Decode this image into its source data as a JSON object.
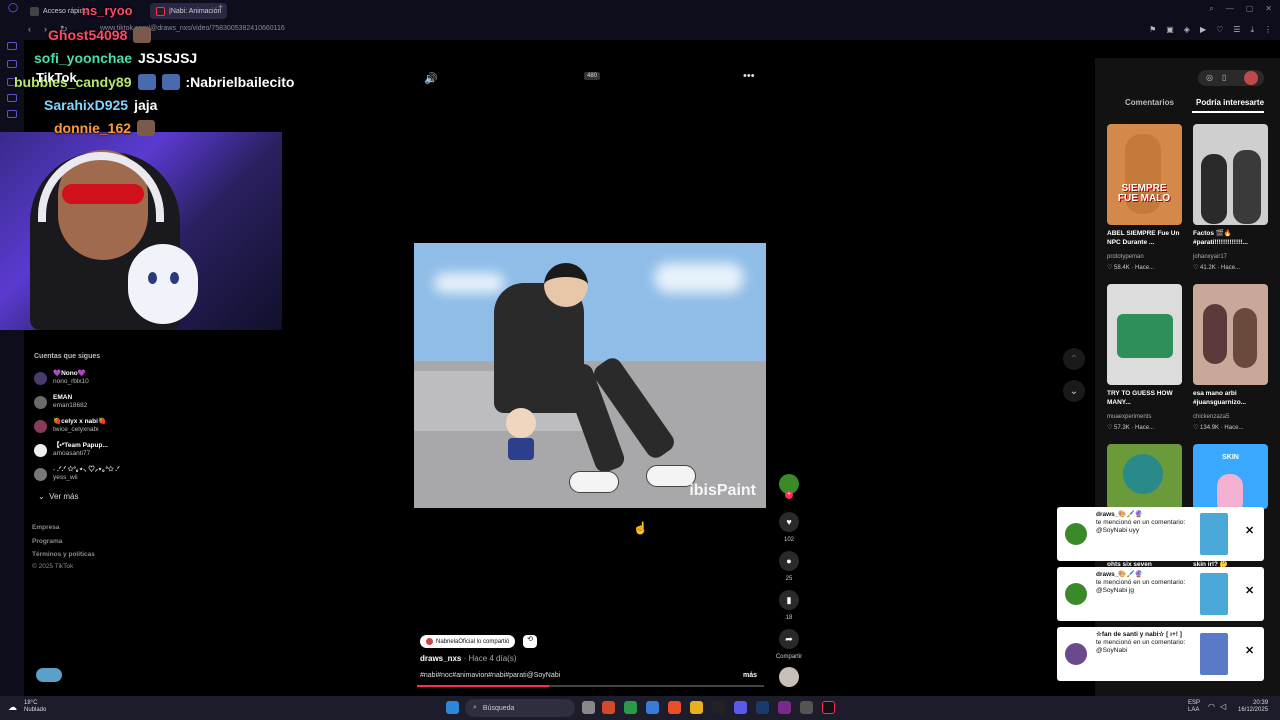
{
  "browser": {
    "tabs": [
      {
        "label": "Acceso rápido"
      },
      {
        "label": "|Nabi: Animación"
      }
    ],
    "url": "www.tiktok.com/@draws_nxs/video/7583005382410660116"
  },
  "chat": {
    "lines": [
      {
        "user": "Ghost54098",
        "message": "",
        "color": "#ff4a6a"
      },
      {
        "user": "sofi_yoonchae",
        "message": "JSJSJSJ",
        "color": "#46e0a8"
      },
      {
        "user": "bubbles_candy89",
        "message": ":Nabrielbailecito",
        "color": "#b6e86a"
      },
      {
        "user": "SarahixD925",
        "message": "jaja",
        "color": "#7fd6ff"
      },
      {
        "user": "donnie_162",
        "message": "",
        "color": "#ff9a3a"
      }
    ],
    "header_user": "ns_ryoo"
  },
  "tiktok": {
    "logo": "TikTok",
    "following_title": "Cuentas que sigues",
    "following": [
      {
        "name": "💜Nono💜",
        "handle": "nono_rblx10"
      },
      {
        "name": "EMAN",
        "handle": "eman18682"
      },
      {
        "name": "🍓celyx x nabi🍓",
        "handle": "twice_celyxnabi"
      },
      {
        "name": "【•*Team Papup...",
        "handle": "amoasanti77"
      },
      {
        "name": "˖ .ᐟ.ᐟ ✩°｡⋆⸜ ♡⸝⋆｡°✩ .ᐟ",
        "handle": "yess_wii"
      }
    ],
    "see_more": "Ver más",
    "footer": [
      "Empresa",
      "Programa",
      "Términos y políticas",
      "© 2025 TikTok"
    ]
  },
  "video": {
    "watermark": "ibisPaint",
    "quality": "480",
    "actions": {
      "likes": "102",
      "comments": "25",
      "saves": "18",
      "share_label": "Compartir"
    },
    "repost_text": "NabrielaOficial lo compartió",
    "author": "draws_nxs",
    "time_ago": "· Hace 4 día(s)",
    "tags": "#nabi#noc#animavion#nabi#parati@SoyNabi",
    "more": "más",
    "progress": 0.38
  },
  "right_panel": {
    "tabs": [
      "Comentarios",
      "Podría interesarte"
    ],
    "videos": [
      {
        "title": "ABEL SIEMPRE Fue Un NPC Durante ...",
        "user": "prototypeman",
        "stat": "♡ 58.4K · Hace...",
        "thumb_text": "SIEMPRE FUE MALO",
        "color": "#d4894a"
      },
      {
        "title": "Factos 🎬🔥 #parati!!!!!!!!!!!!!...",
        "user": "johanxyair17",
        "stat": "♡ 41.2K · Hace...",
        "thumb_text": "",
        "color": "#cfcfcf"
      },
      {
        "title": "TRY TO GUESS HOW MANY...",
        "user": "muaexperiments",
        "stat": "♡ 57.3K · Hace...",
        "thumb_text": "",
        "color": "#2f8f5a"
      },
      {
        "title": "esa mano arbi #juansguarnizo...",
        "user": "chickenzaza5",
        "stat": "♡ 134.9K · Hace...",
        "thumb_text": "",
        "color": "#c9a89a"
      },
      {
        "title": "ohts six seven",
        "user": "",
        "stat": "",
        "thumb_text": "",
        "color": "#6a9a3a"
      },
      {
        "title": "skin irl? 🤔",
        "user": "",
        "stat": "",
        "thumb_text": "SKIN",
        "color": "#3aa8ff"
      }
    ]
  },
  "notifications": [
    {
      "user": "draws_🎨🖌️🔮",
      "text": "te mencionó en un comentario: @SoyNabi uyy"
    },
    {
      "user": "draws_🎨🖌️🔮",
      "text": "te mencionó en un comentario: @SoyNabi jg"
    },
    {
      "user": "☆fan de santi y nabi☆ [ ı+! ]",
      "text": "te mencionó en un comentario: @SoyNabi"
    }
  ],
  "taskbar": {
    "weather_temp": "18°C",
    "weather_desc": "Nublado",
    "search": "Búsqueda",
    "lang1": "ESP",
    "lang2": "LAA",
    "time": "20:39",
    "date": "16/12/2025"
  }
}
